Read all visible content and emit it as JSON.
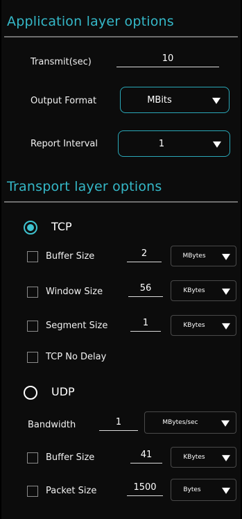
{
  "app_section": {
    "title": "Application layer options",
    "transmit": {
      "label": "Transmit(sec)",
      "value": "10"
    },
    "output_format": {
      "label": "Output Format",
      "value": "MBits"
    },
    "report_interval": {
      "label": "Report Interval",
      "value": "1"
    }
  },
  "transport_section": {
    "title": "Transport layer options",
    "tcp": {
      "label": "TCP",
      "selected": true,
      "buffer_size": {
        "label": "Buffer Size",
        "value": "2",
        "unit": "MBytes",
        "checked": false
      },
      "window_size": {
        "label": "Window Size",
        "value": "56",
        "unit": "KBytes",
        "checked": false
      },
      "segment_size": {
        "label": "Segment Size",
        "value": "1",
        "unit": "KBytes",
        "checked": false
      },
      "no_delay": {
        "label": "TCP No Delay",
        "checked": false
      }
    },
    "udp": {
      "label": "UDP",
      "selected": false,
      "bandwidth": {
        "label": "Bandwidth",
        "value": "1",
        "unit": "MBytes/sec"
      },
      "buffer_size": {
        "label": "Buffer Size",
        "value": "41",
        "unit": "KBytes",
        "checked": false
      },
      "packet_size": {
        "label": "Packet Size",
        "value": "1500",
        "unit": "Bytes",
        "checked": false
      }
    }
  },
  "icons": {
    "dropdown": "triangle-down-icon",
    "radio": "radio-icon",
    "checkbox": "checkbox-icon"
  },
  "colors": {
    "accent": "#35b8c8",
    "background": "#0c0c0c",
    "divider": "#6f6f6f"
  }
}
